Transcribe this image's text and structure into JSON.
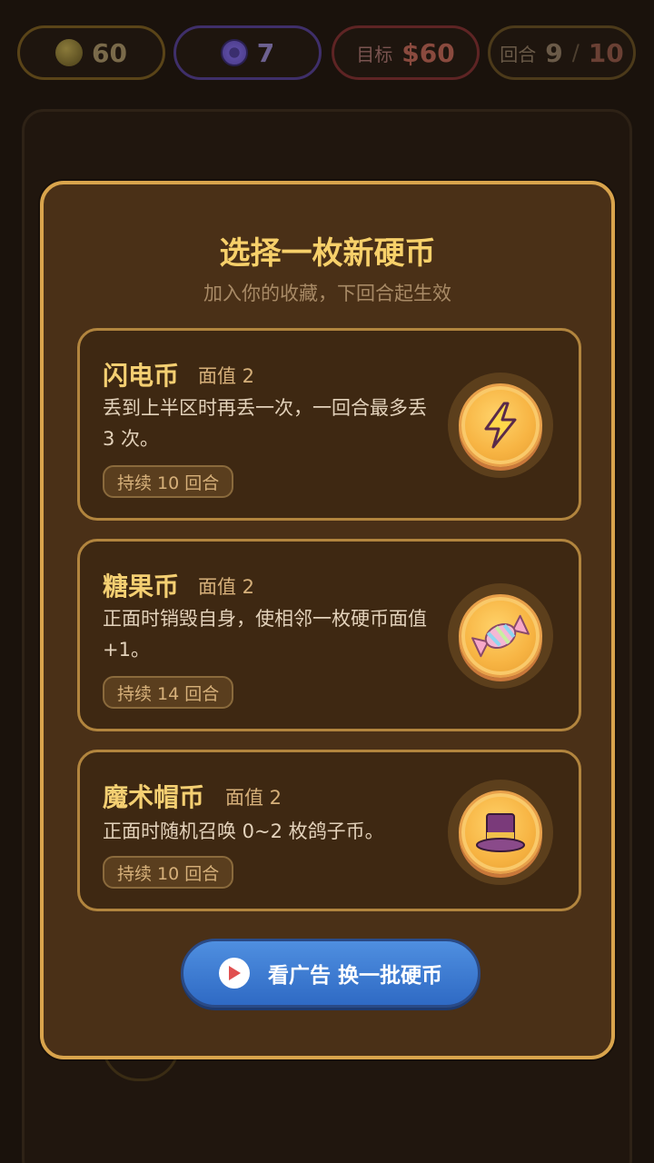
{
  "topbar": {
    "coins": "60",
    "tokens": "7",
    "goal_label": "目标",
    "goal_value": "$60",
    "round_label": "回合",
    "round_current": "9",
    "round_sep": "/",
    "round_max": "10"
  },
  "modal": {
    "title": "选择一枚新硬币",
    "subtitle": "加入你的收藏，下回合起生效",
    "cards": [
      {
        "name": "闪电币",
        "value": "面值 2",
        "desc": "丢到上半区时再丢一次，一回合最多丢 3 次。",
        "duration": "持续 10 回合",
        "icon": "lightning-icon"
      },
      {
        "name": "糖果币",
        "value": "面值 2",
        "desc": "正面时销毁自身，使相邻一枚硬币面值 +1。",
        "duration": "持续 14 回合",
        "icon": "candy-icon"
      },
      {
        "name": "魔术帽币",
        "value": "面值 2",
        "desc": "正面时随机召唤 0~2 枚鸽子币。",
        "duration": "持续 10 回合",
        "icon": "top-hat-icon"
      }
    ],
    "ad_button": "看广告 换一批硬币"
  },
  "colors": {
    "gold_border": "#d9a44c",
    "title": "#f7d06a",
    "button_blue": "#3d7dd6"
  }
}
